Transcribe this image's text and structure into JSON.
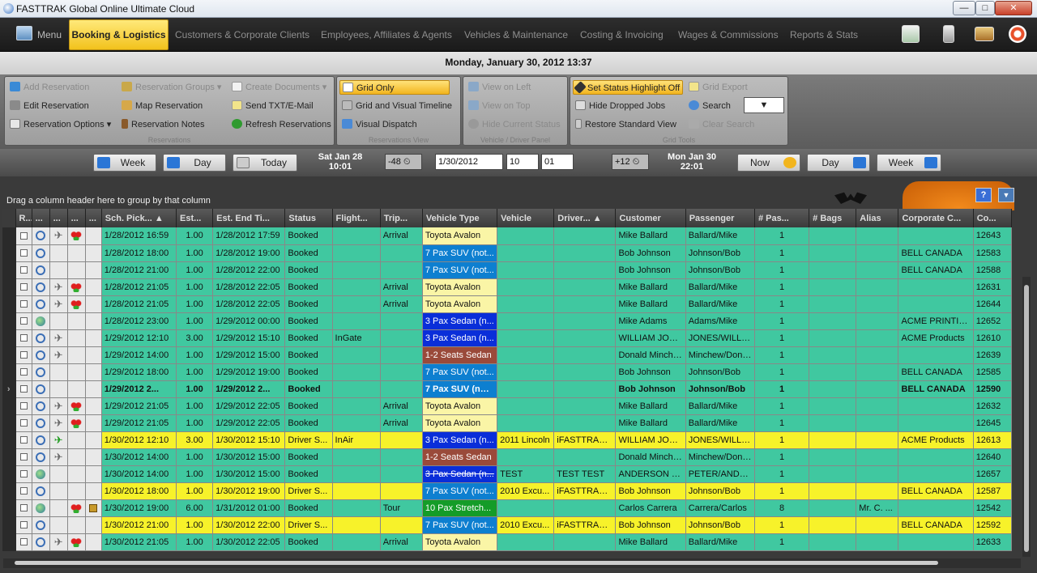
{
  "window": {
    "title": "FASTTRAK Global Online Ultimate Cloud",
    "min": "—",
    "max": "□",
    "close": "✕"
  },
  "menubar": {
    "menu_label": "Menu",
    "active": "Booking & Logistics",
    "items": [
      "Customers & Corporate Clients",
      "Employees, Affiliates & Agents",
      "Vehicles & Maintenance",
      "Costing & Invoicing",
      "Wages & Commissions",
      "Reports & Stats"
    ]
  },
  "datebar": {
    "text": "Monday, January 30, 2012 13:37"
  },
  "ribbon": {
    "g1": {
      "label": "Reservations",
      "items": [
        "Add Reservation",
        "Edit Reservation",
        "Reservation Options ▾",
        "Reservation Groups ▾",
        "Map Reservation",
        "Reservation Notes",
        "Create Documents ▾",
        "Send TXT/E-Mail",
        "Refresh Reservations"
      ]
    },
    "g2": {
      "label": "Reservations View",
      "items": [
        "Grid Only",
        "Grid and Visual Timeline",
        "Visual Dispatch"
      ]
    },
    "g3": {
      "label": "Vehicle / Driver Panel",
      "items": [
        "View on Left",
        "View on Top",
        "Hide Current Status"
      ]
    },
    "g4": {
      "label": "Grid Tools",
      "items": [
        "Set Status Highlight Off",
        "Hide Dropped Jobs",
        "Restore Standard View",
        "Grid Export",
        "Search",
        "Clear Search"
      ]
    }
  },
  "nav": {
    "week": "Week",
    "day": "Day",
    "today": "Today",
    "start_day": "Sat Jan 28",
    "start_time": "10:01",
    "minus": "-48",
    "date": "1/30/2012",
    "hour": "10",
    "minute": "01",
    "plus": "+12",
    "end_day": "Mon Jan 30",
    "end_time": "22:01",
    "now": "Now",
    "day2": "Day",
    "week2": "Week"
  },
  "grid": {
    "group_hint": "Drag a column header here to group by that column",
    "columns": [
      "R...",
      "...",
      "...",
      "...",
      "...",
      "Sch. Pick... ▲",
      "Est...",
      "Est. End Ti...",
      "Status",
      "Flight...",
      "Trip...",
      "Vehicle Type",
      "Vehicle",
      "Driver... ▲",
      "Customer",
      "Passenger",
      "# Pas...",
      "# Bags",
      "Alias",
      "Corporate C...",
      "Co..."
    ],
    "rows": [
      {
        "flags": "pl",
        "pick": "1/28/2012 16:59",
        "est": "1.00",
        "end": "1/28/2012 17:59",
        "status": "Booked",
        "flight": "",
        "trip": "Arrival",
        "vt": "Toyota Avalon",
        "vtc": "vt-yellow",
        "veh": "",
        "drv": "",
        "cust": "Mike Ballard",
        "pax": "Ballard/Mike",
        "n": "1",
        "bags": "",
        "alias": "",
        "corp": "",
        "co": "12643"
      },
      {
        "flags": "",
        "pick": "1/28/2012 18:00",
        "est": "1.00",
        "end": "1/28/2012 19:00",
        "status": "Booked",
        "flight": "",
        "trip": "",
        "vt": "7 Pax SUV (not...",
        "vtc": "vt-blue",
        "veh": "",
        "drv": "",
        "cust": "Bob Johnson",
        "pax": "Johnson/Bob",
        "n": "1",
        "bags": "",
        "alias": "",
        "corp": "BELL CANADA",
        "co": "12583"
      },
      {
        "flags": "",
        "pick": "1/28/2012 21:00",
        "est": "1.00",
        "end": "1/28/2012 22:00",
        "status": "Booked",
        "flight": "",
        "trip": "",
        "vt": "7 Pax SUV (not...",
        "vtc": "vt-blue",
        "veh": "",
        "drv": "",
        "cust": "Bob Johnson",
        "pax": "Johnson/Bob",
        "n": "1",
        "bags": "",
        "alias": "",
        "corp": "BELL CANADA",
        "co": "12588"
      },
      {
        "flags": "pl",
        "pick": "1/28/2012 21:05",
        "est": "1.00",
        "end": "1/28/2012 22:05",
        "status": "Booked",
        "flight": "",
        "trip": "Arrival",
        "vt": "Toyota Avalon",
        "vtc": "vt-yellow",
        "veh": "",
        "drv": "",
        "cust": "Mike Ballard",
        "pax": "Ballard/Mike",
        "n": "1",
        "bags": "",
        "alias": "",
        "corp": "",
        "co": "12631"
      },
      {
        "flags": "pl",
        "pick": "1/28/2012 21:05",
        "est": "1.00",
        "end": "1/28/2012 22:05",
        "status": "Booked",
        "flight": "",
        "trip": "Arrival",
        "vt": "Toyota Avalon",
        "vtc": "vt-yellow",
        "veh": "",
        "drv": "",
        "cust": "Mike Ballard",
        "pax": "Ballard/Mike",
        "n": "1",
        "bags": "",
        "alias": "",
        "corp": "",
        "co": "12644"
      },
      {
        "flags": "g",
        "pick": "1/28/2012 23:00",
        "est": "1.00",
        "end": "1/29/2012 00:00",
        "status": "Booked",
        "flight": "",
        "trip": "",
        "vt": "3 Pax Sedan (n...",
        "vtc": "vt-dblue",
        "veh": "",
        "drv": "",
        "cust": "Mike Adams",
        "pax": "Adams/Mike",
        "n": "1",
        "bags": "",
        "alias": "",
        "corp": "ACME PRINTIN...",
        "co": "12652"
      },
      {
        "flags": "p",
        "pick": "1/29/2012 12:10",
        "est": "3.00",
        "end": "1/29/2012 15:10",
        "status": "Booked",
        "flight": "InGate",
        "trip": "",
        "vt": "3 Pax Sedan (n...",
        "vtc": "vt-dblue",
        "veh": "",
        "drv": "",
        "cust": "WILLIAM JONES",
        "pax": "JONES/WILLIAM",
        "n": "1",
        "bags": "",
        "alias": "",
        "corp": "ACME Products",
        "co": "12610"
      },
      {
        "flags": "p",
        "pick": "1/29/2012 14:00",
        "est": "1.00",
        "end": "1/29/2012 15:00",
        "status": "Booked",
        "flight": "",
        "trip": "",
        "vt": "1-2 Seats Sedan",
        "vtc": "vt-brown",
        "veh": "",
        "drv": "",
        "cust": "Donald Minchew",
        "pax": "Minchew/Donald",
        "n": "1",
        "bags": "",
        "alias": "",
        "corp": "",
        "co": "12639"
      },
      {
        "flags": "",
        "pick": "1/29/2012 18:00",
        "est": "1.00",
        "end": "1/29/2012 19:00",
        "status": "Booked",
        "flight": "",
        "trip": "",
        "vt": "7 Pax SUV (not...",
        "vtc": "vt-blue",
        "veh": "",
        "drv": "",
        "cust": "Bob Johnson",
        "pax": "Johnson/Bob",
        "n": "1",
        "bags": "",
        "alias": "",
        "corp": "BELL CANADA",
        "co": "12585"
      },
      {
        "flags": "",
        "pick": "1/29/2012 2...",
        "est": "1.00",
        "end": "1/29/2012 2...",
        "status": "Booked",
        "flight": "",
        "trip": "",
        "vt": "7 Pax SUV (not...",
        "vtc": "vt-blue",
        "veh": "",
        "drv": "",
        "cust": "Bob Johnson",
        "pax": "Johnson/Bob",
        "n": "1",
        "bags": "",
        "alias": "",
        "corp": "BELL CANADA",
        "co": "12590",
        "bold": true,
        "cur": true
      },
      {
        "flags": "pl",
        "pick": "1/29/2012 21:05",
        "est": "1.00",
        "end": "1/29/2012 22:05",
        "status": "Booked",
        "flight": "",
        "trip": "Arrival",
        "vt": "Toyota Avalon",
        "vtc": "vt-yellow",
        "veh": "",
        "drv": "",
        "cust": "Mike Ballard",
        "pax": "Ballard/Mike",
        "n": "1",
        "bags": "",
        "alias": "",
        "corp": "",
        "co": "12632"
      },
      {
        "flags": "pl",
        "pick": "1/29/2012 21:05",
        "est": "1.00",
        "end": "1/29/2012 22:05",
        "status": "Booked",
        "flight": "",
        "trip": "Arrival",
        "vt": "Toyota Avalon",
        "vtc": "vt-yellow",
        "veh": "",
        "drv": "",
        "cust": "Mike Ballard",
        "pax": "Ballard/Mike",
        "n": "1",
        "bags": "",
        "alias": "",
        "corp": "",
        "co": "12645"
      },
      {
        "flags": "pG",
        "pick": "1/30/2012 12:10",
        "est": "3.00",
        "end": "1/30/2012 15:10",
        "status": "Driver S...",
        "flight": "InAir",
        "trip": "",
        "vt": "3 Pax Sedan (n...",
        "vtc": "vt-dblue",
        "veh": "2011 Lincoln",
        "drv": "iFASTTRAK ...",
        "cust": "WILLIAM JONES",
        "pax": "JONES/WILLIAM",
        "n": "1",
        "bags": "",
        "alias": "",
        "corp": "ACME Products",
        "co": "12613",
        "yellow": true
      },
      {
        "flags": "p",
        "pick": "1/30/2012 14:00",
        "est": "1.00",
        "end": "1/30/2012 15:00",
        "status": "Booked",
        "flight": "",
        "trip": "",
        "vt": "1-2 Seats Sedan",
        "vtc": "vt-brown",
        "veh": "",
        "drv": "",
        "cust": "Donald Minchew",
        "pax": "Minchew/Donald",
        "n": "1",
        "bags": "",
        "alias": "",
        "corp": "",
        "co": "12640"
      },
      {
        "flags": "g",
        "pick": "1/30/2012 14:00",
        "est": "1.00",
        "end": "1/30/2012 15:00",
        "status": "Booked",
        "flight": "",
        "trip": "",
        "vt": "3 Pax Sedan (n...",
        "vtc": "vt-dblue vt-strike",
        "veh": "TEST",
        "drv": "TEST TEST",
        "cust": "ANDERSON P...",
        "pax": "PETER/ANDE...",
        "n": "1",
        "bags": "",
        "alias": "",
        "corp": "",
        "co": "12657"
      },
      {
        "flags": "",
        "pick": "1/30/2012 18:00",
        "est": "1.00",
        "end": "1/30/2012 19:00",
        "status": "Driver S...",
        "flight": "",
        "trip": "",
        "vt": "7 Pax SUV (not...",
        "vtc": "vt-blue",
        "veh": "2010 Excu...",
        "drv": "iFASTTRAK ...",
        "cust": "Bob Johnson",
        "pax": "Johnson/Bob",
        "n": "1",
        "bags": "",
        "alias": "",
        "corp": "BELL CANADA",
        "co": "12587",
        "yellow": true
      },
      {
        "flags": "glb",
        "pick": "1/30/2012 19:00",
        "est": "6.00",
        "end": "1/31/2012 01:00",
        "status": "Booked",
        "flight": "",
        "trip": "Tour",
        "vt": "10 Pax Stretch...",
        "vtc": "vt-green",
        "veh": "",
        "drv": "",
        "cust": "Carlos Carrera",
        "pax": "Carrera/Carlos",
        "n": "8",
        "bags": "",
        "alias": "Mr. C. ...",
        "corp": "",
        "co": "12542"
      },
      {
        "flags": "",
        "pick": "1/30/2012 21:00",
        "est": "1.00",
        "end": "1/30/2012 22:00",
        "status": "Driver S...",
        "flight": "",
        "trip": "",
        "vt": "7 Pax SUV (not...",
        "vtc": "vt-blue",
        "veh": "2010 Excu...",
        "drv": "iFASTTRAK ...",
        "cust": "Bob Johnson",
        "pax": "Johnson/Bob",
        "n": "1",
        "bags": "",
        "alias": "",
        "corp": "BELL CANADA",
        "co": "12592",
        "yellow": true
      },
      {
        "flags": "pl",
        "pick": "1/30/2012 21:05",
        "est": "1.00",
        "end": "1/30/2012 22:05",
        "status": "Booked",
        "flight": "",
        "trip": "Arrival",
        "vt": "Toyota Avalon",
        "vtc": "vt-yellow",
        "veh": "",
        "drv": "",
        "cust": "Mike Ballard",
        "pax": "Ballard/Mike",
        "n": "1",
        "bags": "",
        "alias": "",
        "corp": "",
        "co": "12633"
      }
    ]
  }
}
